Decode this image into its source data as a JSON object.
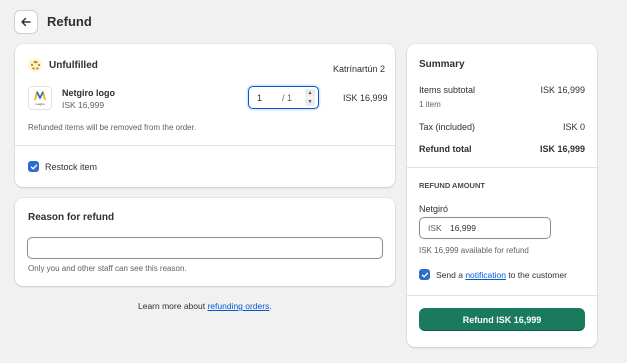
{
  "header": {
    "title": "Refund"
  },
  "fulfillment": {
    "status": "Unfulfilled",
    "location": "Katrínartún 2",
    "item": {
      "name": "Netgiro logo",
      "thumb_text": "netgiro",
      "price": "ISK 16,999",
      "qty_value": "1",
      "qty_max": "/ 1",
      "total": "ISK 16,999"
    },
    "note": "Refunded items will be removed from the order.",
    "restock_label": "Restock item"
  },
  "reason": {
    "title": "Reason for refund",
    "input_value": "",
    "help": "Only you and other staff can see this reason."
  },
  "footer": {
    "learn_prefix": "Learn more about ",
    "learn_link": "refunding orders",
    "learn_suffix": "."
  },
  "summary": {
    "title": "Summary",
    "subtotal_label": "Items subtotal",
    "subtotal_value": "ISK 16,999",
    "items_count": "1 item",
    "tax_label": "Tax (included)",
    "tax_value": "ISK 0",
    "total_label": "Refund total",
    "total_value": "ISK 16,999",
    "refund_amount_heading": "REFUND AMOUNT",
    "method_label": "Netgiró",
    "currency_prefix": "ISK",
    "amount_value": "16,999",
    "available": "ISK 16,999 available for refund",
    "send_prefix": "Send a ",
    "send_link": "notification",
    "send_suffix": " to the customer",
    "refund_button": "Refund ISK 16,999"
  },
  "colors": {
    "primary_button": "#1a7a5e",
    "link": "#005bd3",
    "checkbox": "#2c6ecb",
    "status_unfulfilled": "#b98900"
  }
}
